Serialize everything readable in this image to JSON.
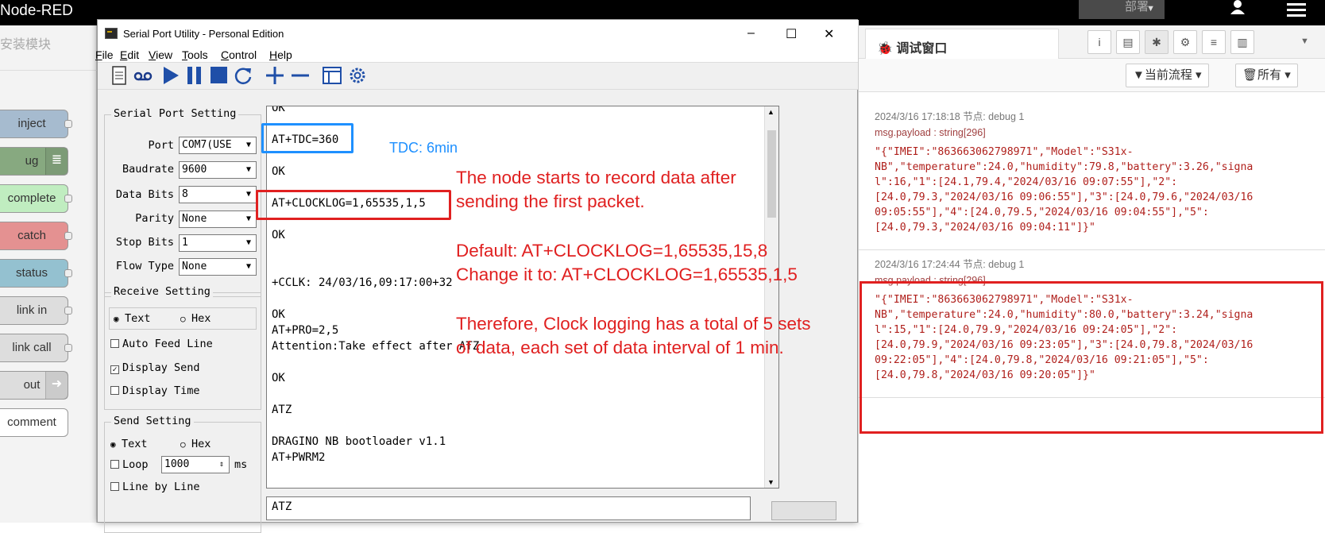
{
  "nodered": {
    "title": "Node-RED",
    "deploy_label": "部署",
    "palette_search": "安装模块",
    "nodes": [
      {
        "label": "inject",
        "color": "#a6bbcf"
      },
      {
        "label": "ug",
        "color": "#87a980"
      },
      {
        "label": "complete",
        "color": "#c0edc0"
      },
      {
        "label": "catch",
        "color": "#e49191"
      },
      {
        "label": "status",
        "color": "#94c1d0"
      },
      {
        "label": "link in",
        "color": "#dddddd"
      },
      {
        "label": "link call",
        "color": "#dddddd"
      },
      {
        "label": "out",
        "color": "#dddddd"
      },
      {
        "label": "comment",
        "color": "#ffffff"
      }
    ]
  },
  "serial_window": {
    "title": "Serial Port Utility - Personal Edition",
    "controls": {
      "minimize": "–",
      "maximize": "☐",
      "close": "✕"
    },
    "menu": [
      {
        "key": "F",
        "rest": "ile"
      },
      {
        "key": "E",
        "rest": "dit"
      },
      {
        "key": "V",
        "rest": "iew"
      },
      {
        "key": "T",
        "rest": "ools"
      },
      {
        "key": "C",
        "rest": "ontrol"
      },
      {
        "key": "H",
        "rest": "elp"
      }
    ],
    "port_setting": {
      "title": "Serial Port Setting",
      "port_label": "Port",
      "port_value": "COM7(USE",
      "baud_label": "Baudrate",
      "baud_value": "9600",
      "databits_label": "Data Bits",
      "databits_value": "8",
      "parity_label": "Parity",
      "parity_value": "None",
      "stopbits_label": "Stop Bits",
      "stopbits_value": "1",
      "flow_label": "Flow Type",
      "flow_value": "None"
    },
    "receive_setting": {
      "title": "Receive Setting",
      "text_label": "Text",
      "hex_label": "Hex",
      "auto_feed": "Auto Feed Line",
      "display_send": "Display Send",
      "display_time": "Display Time"
    },
    "send_setting": {
      "title": "Send Setting",
      "text_label": "Text",
      "hex_label": "Hex",
      "loop_label": "Loop",
      "loop_value": "1000",
      "loop_unit": "ms",
      "line_by_line": "Line by Line"
    },
    "terminal_lines": [
      "OK",
      "AT+TDC=360",
      "OK",
      "AT+CLOCKLOG=1,65535,1,5",
      "OK",
      "+CCLK: 24/03/16,09:17:00+32",
      "OK",
      "AT+PRO=2,5",
      "Attention:Take effect after ATZ",
      "OK",
      "ATZ",
      "DRAGINO NB bootloader v1.1",
      "AT+PWRM2"
    ],
    "send_text": "ATZ",
    "annotations": {
      "tdc": "TDC: 6min",
      "note1_line1": "The node starts to record data after",
      "note1_line2": "sending the first packet.",
      "note2_line1": "Default: AT+CLOCKLOG=1,65535,15,8",
      "note2_line2": "Change it to: AT+CLOCKLOG=1,65535,1,5",
      "note3_line1": "Therefore, Clock logging has a total of 5 sets",
      "note3_line2": "of data, each set of data interval of 1 min."
    }
  },
  "debug": {
    "tab_label": "调试窗口",
    "filter_flow": "当前流程",
    "filter_all": "所有",
    "messages": [
      {
        "meta": "2024/3/16 17:18:18   节点: debug 1",
        "path": "msg.payload : string[296]",
        "lines": [
          "\"{\"IMEI\":\"863663062798971\",\"Model\":\"S31x-",
          "NB\",\"temperature\":24.0,\"humidity\":79.8,\"battery\":3.26,\"signa",
          "l\":16,\"1\":[24.1,79.4,\"2024/03/16 09:07:55\"],\"2\":",
          "[24.0,79.3,\"2024/03/16 09:06:55\"],\"3\":[24.0,79.6,\"2024/03/16",
          "09:05:55\"],\"4\":[24.0,79.5,\"2024/03/16 09:04:55\"],\"5\":",
          "[24.0,79.3,\"2024/03/16 09:04:11\"]}\""
        ]
      },
      {
        "meta": "2024/3/16 17:24:44   节点: debug 1",
        "path": "msg.payload : string[296]",
        "lines": [
          "\"{\"IMEI\":\"863663062798971\",\"Model\":\"S31x-",
          "NB\",\"temperature\":24.0,\"humidity\":80.0,\"battery\":3.24,\"signa",
          "l\":15,\"1\":[24.0,79.9,\"2024/03/16 09:24:05\"],\"2\":",
          "[24.0,79.9,\"2024/03/16 09:23:05\"],\"3\":[24.0,79.8,\"2024/03/16",
          "09:22:05\"],\"4\":[24.0,79.8,\"2024/03/16 09:21:05\"],\"5\":",
          "[24.0,79.8,\"2024/03/16 09:20:05\"]}\""
        ]
      }
    ]
  },
  "colors": {
    "highlight_red": "#e02020",
    "highlight_blue": "#1e90ff",
    "payload_text": "#b0201c"
  }
}
